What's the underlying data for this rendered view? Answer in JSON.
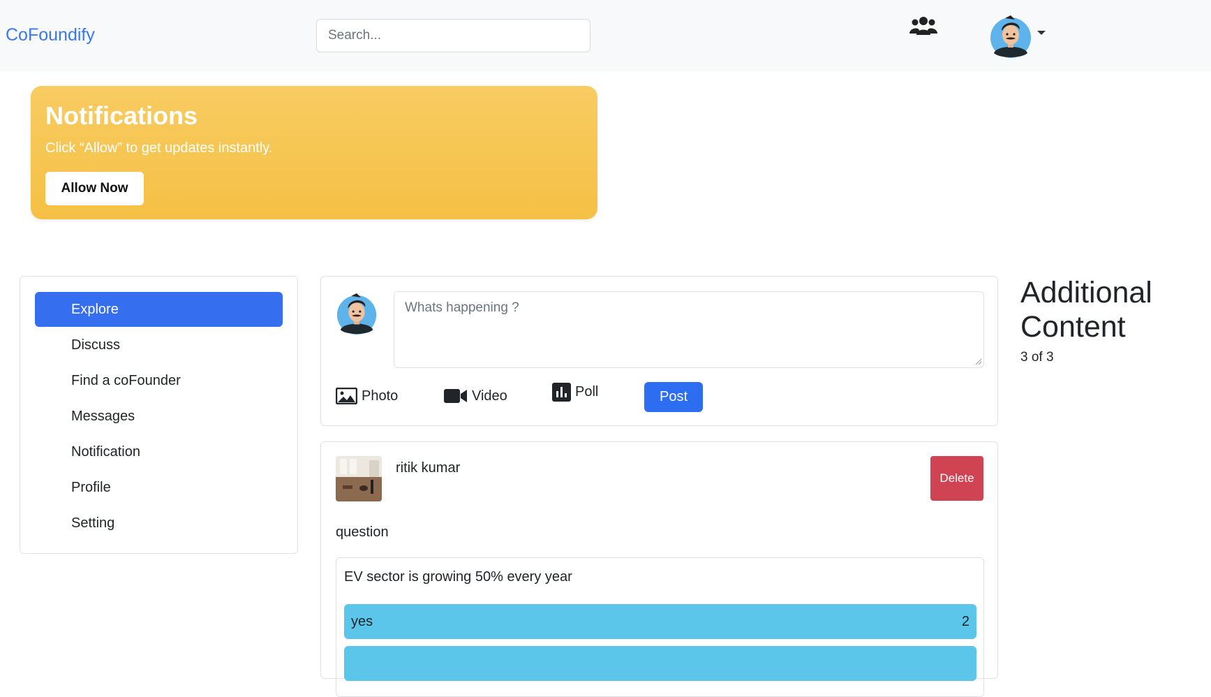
{
  "navbar": {
    "brand": "CoFoundify",
    "search_placeholder": "Search...",
    "people_icon": "people-group-icon",
    "avatar_icon": "user-avatar-icon",
    "dropdown_icon": "caret-down-icon"
  },
  "notification_banner": {
    "title": "Notifications",
    "text": "Click “Allow” to get updates instantly.",
    "button_label": "Allow Now",
    "color": "#f5c044"
  },
  "sidebar": {
    "items": [
      {
        "label": "Explore",
        "active": true
      },
      {
        "label": "Discuss",
        "active": false
      },
      {
        "label": "Find a coFounder",
        "active": false
      },
      {
        "label": "Messages",
        "active": false
      },
      {
        "label": "Notification",
        "active": false
      },
      {
        "label": "Profile",
        "active": false
      },
      {
        "label": "Setting",
        "active": false
      }
    ],
    "active_color": "#366ef0"
  },
  "composer": {
    "placeholder": "Whats happening ?",
    "actions": [
      {
        "label": "Photo",
        "icon": "image-icon"
      },
      {
        "label": "Video",
        "icon": "video-camera-icon"
      },
      {
        "label": "Poll",
        "icon": "poll-chart-icon"
      }
    ],
    "post_label": "Post",
    "post_color": "#2c6df1"
  },
  "post": {
    "author": "ritik kumar",
    "delete_label": "Delete",
    "delete_color": "#d04353",
    "kind": "question",
    "poll": {
      "question": "EV sector is growing 50% every year",
      "options": [
        {
          "label": "yes",
          "count": "2"
        },
        {
          "label": "",
          "count": ""
        }
      ],
      "option_color": "#5bc6e9"
    }
  },
  "additional": {
    "title": "Additional Content",
    "count": "3 of 3"
  }
}
